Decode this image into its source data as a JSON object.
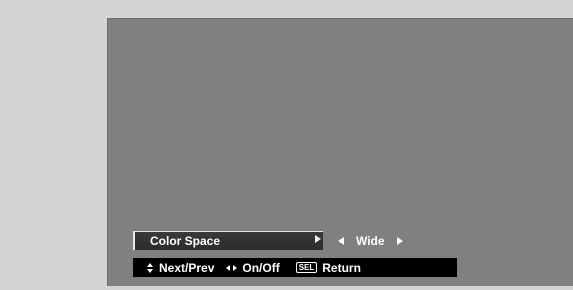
{
  "menu": {
    "setting_label": "Color Space",
    "setting_value": "Wide"
  },
  "hints": {
    "next_prev": "Next/Prev",
    "on_off": "On/Off",
    "sel_key": "SEL",
    "return": "Return"
  },
  "icons": {
    "row_arrow": "triangle-right-icon",
    "value_left": "triangle-left-icon",
    "value_right": "triangle-right-icon",
    "next_prev": "up-down-arrows-icon",
    "on_off": "left-right-arrows-icon",
    "return": "sel-key-icon"
  },
  "colors": {
    "page_background": "#d4d4d4",
    "screen_background": "#808080",
    "menu_bar": "#2b2b2b",
    "hint_bar": "#000000",
    "text": "#ffffff"
  }
}
